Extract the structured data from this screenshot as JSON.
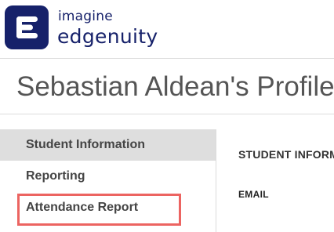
{
  "brand": {
    "name_top": "imagine",
    "name_main": "edgenuity",
    "logo_icon": "edgenuity-e-icon",
    "color": "#16216a"
  },
  "page_title": "Sebastian Aldean's Profile",
  "sidebar": {
    "items": [
      {
        "label": "Student Information",
        "active": true
      },
      {
        "label": "Reporting",
        "active": false
      },
      {
        "label": "Attendance Report",
        "active": false,
        "highlighted": true
      }
    ],
    "highlight_color": "#ec6461"
  },
  "main": {
    "section_heading": "STUDENT INFORMATION",
    "fields": [
      {
        "label": "EMAIL"
      }
    ]
  }
}
